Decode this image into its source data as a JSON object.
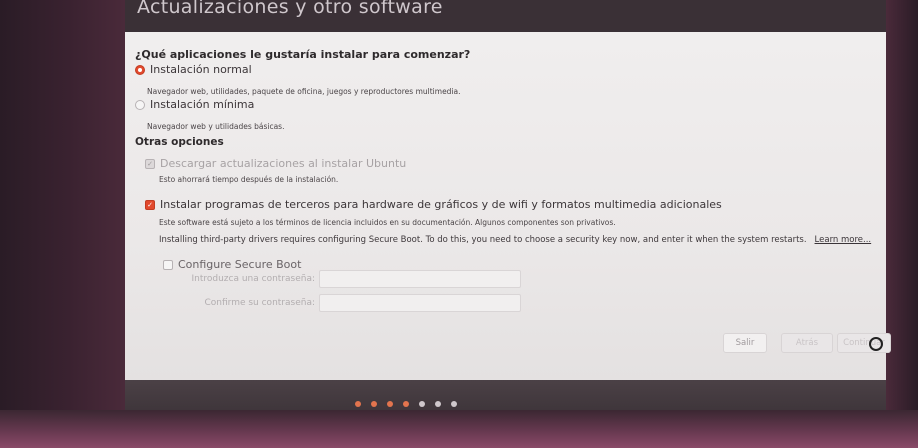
{
  "window": {
    "title": "Actualizaciones y otro software"
  },
  "question": "¿Qué aplicaciones le gustaría instalar para comenzar?",
  "install_options": [
    {
      "label": "Instalación normal",
      "desc": "Navegador web, utilidades, paquete de oficina, juegos y reproductores multimedia.",
      "selected": true
    },
    {
      "label": "Instalación mínima",
      "desc": "Navegador web y utilidades básicas.",
      "selected": false
    }
  ],
  "other_options": {
    "heading": "Otras opciones",
    "download_updates": {
      "label": "Descargar actualizaciones al instalar Ubuntu",
      "desc": "Esto ahorrará tiempo después de la instalación.",
      "checked": true,
      "enabled": false
    },
    "third_party": {
      "label": "Instalar programas de terceros para hardware de gráficos y de wifi y formatos multimedia adicionales",
      "desc": "Este software está sujeto a los términos de licencia incluidos en su documentación. Algunos componentes son privativos.",
      "checked": true
    },
    "secure_boot_note": "Installing third-party drivers requires configuring Secure Boot. To do this, you need to choose a security key now, and enter it when the system restarts.",
    "learn_more": "Learn more...",
    "configure_secure_boot": {
      "label": "Configure Secure Boot",
      "checked": false
    },
    "password_label": "Introduzca una contraseña:",
    "confirm_label": "Confirme su contraseña:"
  },
  "buttons": {
    "quit": "Salir",
    "back": "Atrás",
    "continue": "Continuar"
  },
  "progress_dots": [
    {
      "color": "#e2744e",
      "active": true
    },
    {
      "color": "#e2744e",
      "active": true
    },
    {
      "color": "#e2744e",
      "active": true
    },
    {
      "color": "#e2744e",
      "active": true
    },
    {
      "color": "#cfc8cc",
      "active": false
    },
    {
      "color": "#cfc8cc",
      "active": false
    },
    {
      "color": "#cfc8cc",
      "active": false
    }
  ],
  "colors": {
    "accent": "#e2492d",
    "panel": "#efeded",
    "titlebar": "#3a3036"
  }
}
